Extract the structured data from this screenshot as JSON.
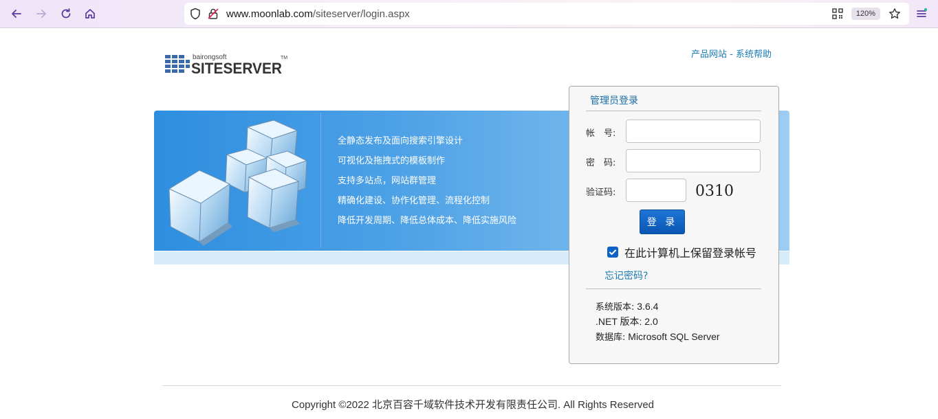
{
  "browser": {
    "url_host": "www.moonlab.com",
    "url_path": "/siteserver/login.aspx",
    "zoom": "120%"
  },
  "header": {
    "logo_small": "bairongsoft",
    "logo_big": "SITESERVER",
    "logo_tm": "TM",
    "link_product": "产品网站",
    "link_sep": " - ",
    "link_help": "系统帮助"
  },
  "banner": {
    "features": [
      "全静态发布及面向搜索引擎设计",
      "可视化及拖拽式的模板制作",
      "支持多站点，网站群管理",
      "精确化建设、协作化管理、流程化控制",
      "降低开发周期、降低总体成本、降低实施风险"
    ]
  },
  "login": {
    "title": "管理员登录",
    "account_label": "帐　号:",
    "account_value": "",
    "password_label": "密　码:",
    "password_value": "",
    "captcha_label": "验证码:",
    "captcha_value": "",
    "captcha_code": "0310",
    "submit_label": "登 录",
    "remember_label": "在此计算机上保留登录帐号",
    "remember_checked": true,
    "forgot_label": "忘记密码?",
    "info": [
      {
        "key": "系统版本:",
        "value": " 3.6.4"
      },
      {
        "key": ".NET 版本:",
        "value": " 2.0"
      },
      {
        "key": "数据库:",
        "value": " Microsoft SQL Server"
      }
    ]
  },
  "footer": {
    "copyright": "Copyright ©2022 北京百容千域软件技术开发有限责任公司. All Rights Reserved"
  },
  "colors": {
    "accent": "#1a7bb5",
    "button": "#0a56b4",
    "banner": "#4fa2e6"
  }
}
